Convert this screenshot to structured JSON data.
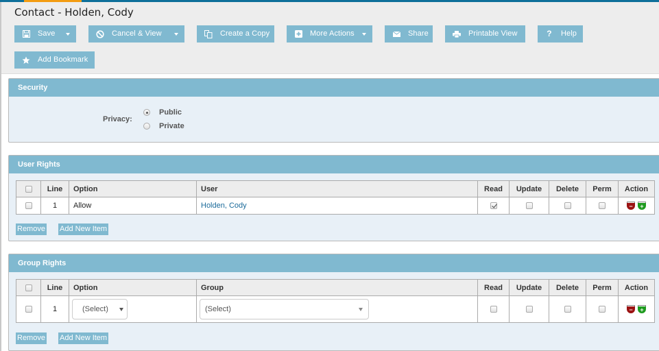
{
  "page": {
    "title": "Contact - Holden, Cody"
  },
  "colors": {
    "topbar": "#0e6f9a",
    "topbar_accent": "#f39c12",
    "button_bg": "#80b9d0",
    "section_bg": "#e8f0f7",
    "link": "#1a6a9a",
    "remove_icon": "#9b1212",
    "add_icon": "#1e9a1e"
  },
  "toolbar": {
    "save": {
      "label": "Save",
      "icon": "floppy-disk-icon",
      "has_dropdown": true
    },
    "cancel_view": {
      "label": "Cancel & View",
      "icon": "ban-icon",
      "has_dropdown": true
    },
    "create_copy": {
      "label": "Create a Copy",
      "icon": "copy-icon"
    },
    "more_actions": {
      "label": "More Actions",
      "icon": "plus-square-icon",
      "has_dropdown": true
    },
    "share": {
      "label": "Share",
      "icon": "envelope-icon"
    },
    "printable_view": {
      "label": "Printable View",
      "icon": "printer-icon"
    },
    "help": {
      "label": "Help",
      "icon": "question-icon"
    },
    "add_bookmark": {
      "label": "Add Bookmark",
      "icon": "star-icon"
    }
  },
  "security": {
    "title": "Security",
    "privacy_label": "Privacy:",
    "options": [
      {
        "label": "Public",
        "selected": true
      },
      {
        "label": "Private",
        "selected": false
      }
    ]
  },
  "user_rights": {
    "title": "User Rights",
    "columns": {
      "line": "Line",
      "option": "Option",
      "user": "User",
      "read": "Read",
      "update": "Update",
      "delete": "Delete",
      "perm": "Perm",
      "action": "Action"
    },
    "rows": [
      {
        "line": "1",
        "option": "Allow",
        "user": "Holden, Cody",
        "read": true,
        "update": false,
        "delete": false,
        "perm": false
      }
    ],
    "remove_label": "Remove",
    "add_label": "Add New Item"
  },
  "group_rights": {
    "title": "Group Rights",
    "columns": {
      "line": "Line",
      "option": "Option",
      "group": "Group",
      "read": "Read",
      "update": "Update",
      "delete": "Delete",
      "perm": "Perm",
      "action": "Action"
    },
    "rows": [
      {
        "line": "1",
        "option": "(Select)",
        "group": "(Select)",
        "read": false,
        "update": false,
        "delete": false,
        "perm": false
      }
    ],
    "remove_label": "Remove",
    "add_label": "Add New Item"
  }
}
